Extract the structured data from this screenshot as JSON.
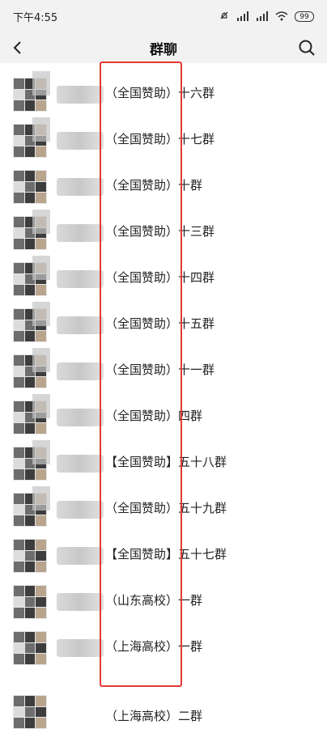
{
  "status_bar": {
    "time": "下午4:55",
    "icons": [
      "mute-icon",
      "signal-icon",
      "signal-icon",
      "wifi-icon"
    ],
    "battery": "99"
  },
  "nav": {
    "title": "群聊",
    "back_icon": "back-chevron-icon",
    "search_icon": "search-icon"
  },
  "groups": [
    {
      "name": "（全国赞助）十六群"
    },
    {
      "name": "（全国赞助）十七群"
    },
    {
      "name": "（全国赞助）十群"
    },
    {
      "name": "（全国赞助）十三群"
    },
    {
      "name": "（全国赞助）十四群"
    },
    {
      "name": "（全国赞助）十五群"
    },
    {
      "name": "（全国赞助）十一群"
    },
    {
      "name": "（全国赞助）四群"
    },
    {
      "name": "【全国赞助】五十八群"
    },
    {
      "name": "（全国赞助）五十九群"
    },
    {
      "name": "【全国赞助】五十七群"
    },
    {
      "name": "（山东高校）一群"
    },
    {
      "name": "（上海高校）一群"
    },
    {
      "name": "（上海高校）二群"
    }
  ],
  "colors": {
    "highlight": "#e53935",
    "bar_bg": "#f2f2f2"
  }
}
